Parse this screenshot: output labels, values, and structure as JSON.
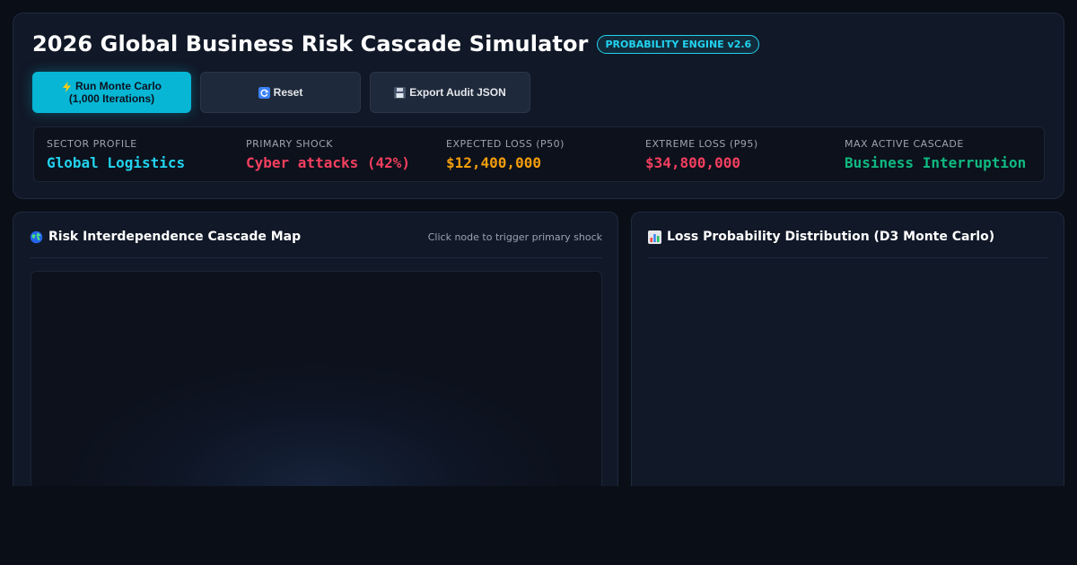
{
  "header": {
    "title": "2026 Global Business Risk Cascade Simulator",
    "badge": "PROBABILITY ENGINE v2.6"
  },
  "toolbar": {
    "run_label_line1": "Run Monte Carlo",
    "run_label_line2": "(1,000 Iterations)",
    "run_icon": "lightning-icon",
    "reset_label": "Reset",
    "reset_icon": "reset-icon",
    "export_label": "Export Audit JSON",
    "export_icon": "floppy-disk-icon"
  },
  "stats": {
    "sector_profile": {
      "label": "SECTOR PROFILE",
      "value": "Global Logistics",
      "color": "#22d3ee"
    },
    "primary_shock": {
      "label": "PRIMARY SHOCK",
      "value": "Cyber attacks (42%)",
      "color": "#f43f5e"
    },
    "expected_loss": {
      "label": "EXPECTED LOSS (P50)",
      "value": "$12,400,000",
      "color": "#f59e0b"
    },
    "extreme_loss": {
      "label": "EXTREME LOSS (P95)",
      "value": "$34,800,000",
      "color": "#f43f5e"
    },
    "max_cascade": {
      "label": "MAX ACTIVE CASCADE",
      "value": "Business Interruption",
      "color": "#10b981"
    }
  },
  "panels": {
    "cascade_map": {
      "title": "Risk Interdependence Cascade Map",
      "icon": "globe-icon",
      "hint": "Click node to trigger primary shock"
    },
    "distribution": {
      "title": "Loss Probability Distribution (D3 Monte Carlo)",
      "icon": "bar-chart-icon"
    }
  },
  "colors": {
    "background": "#0a0e17",
    "card": "#111827",
    "accent": "#06b6d4"
  }
}
